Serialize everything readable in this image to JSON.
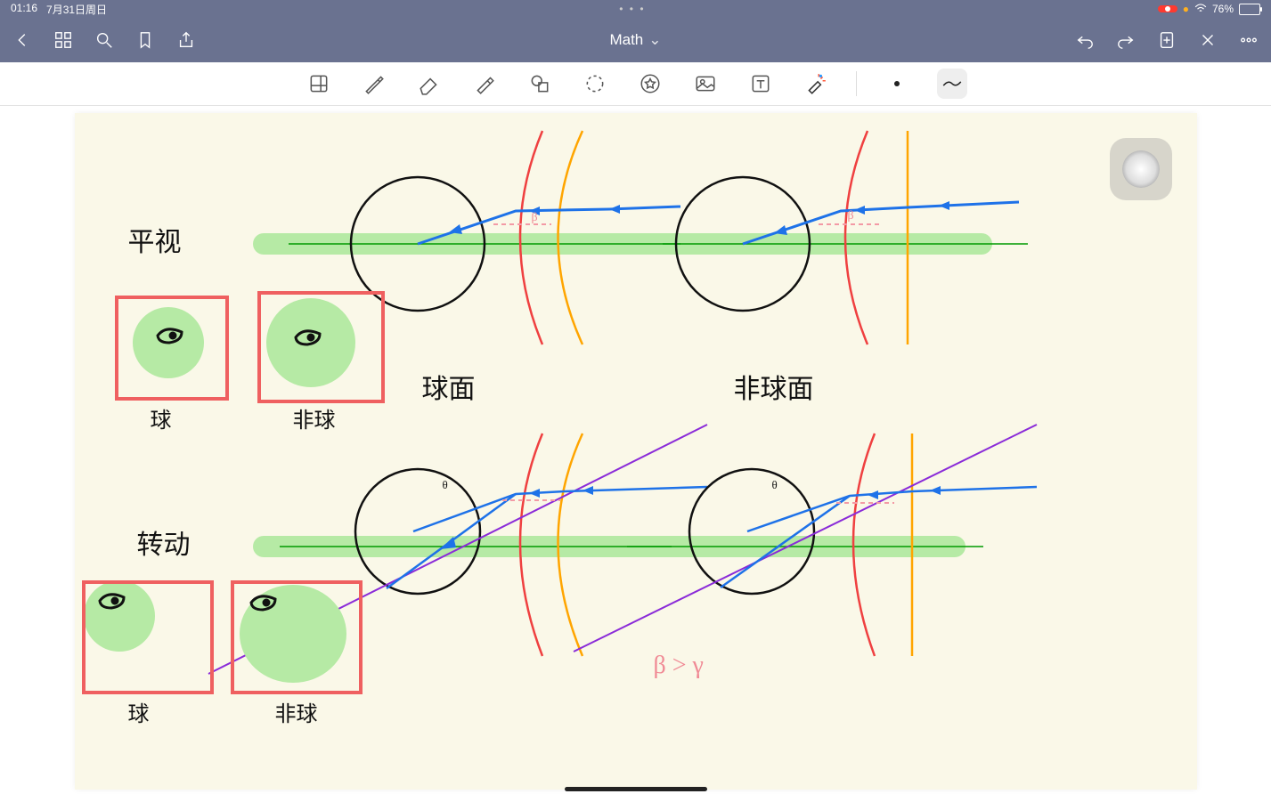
{
  "status": {
    "time": "01:16",
    "date": "7月31日周日",
    "dots": "• • •",
    "battery_pct": "76%",
    "battery_fill": 76
  },
  "title": {
    "doc": "Math",
    "chevron": "⌄"
  },
  "labels": {
    "row1_left": "平视",
    "row1_mid": "球面",
    "row1_right": "非球面",
    "box1a": "球",
    "box1b": "非球",
    "row2_left": "转动",
    "box2a": "球",
    "box2b": "非球",
    "beta_gt_gamma": "β > γ",
    "beta": "β",
    "theta": "θ"
  }
}
